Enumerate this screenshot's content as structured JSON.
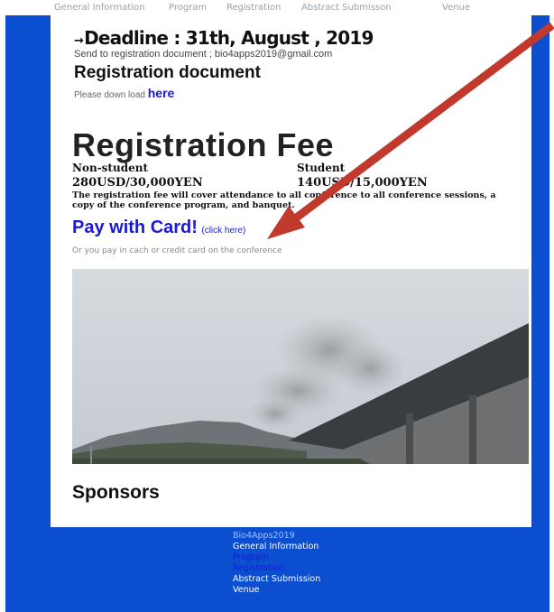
{
  "topnav": {
    "items": [
      "General Information",
      "Program",
      "Registration",
      "Abstract Submisson",
      "Venue"
    ]
  },
  "deadline": {
    "arrow": "→",
    "text": "Deadline : 31th, August , 2019",
    "send_to": "Send to registration document ; bio4apps2019@gmail.com"
  },
  "registration_document": {
    "heading": "Registration document",
    "download_prefix": "Please down load",
    "download_link": "here"
  },
  "fee": {
    "title": "Registration Fee",
    "non_student_label": "Non-student",
    "non_student_price": "280USD/30,000YEN",
    "student_label": "Student",
    "student_price": "140USD/15,000YEN",
    "note": "The registration fee will cover attendance to all conference to all conference sessions, a copy of the conference program, and banquet."
  },
  "payment": {
    "pay_label": "Pay with Card!",
    "click_here": "(click here)",
    "or_pay": "Or you pay in cach or credit card on the conference"
  },
  "sponsors": {
    "heading": "Sponsors"
  },
  "footer": {
    "site_title": "Bio4Apps2019",
    "links": [
      "General Information",
      "Program",
      "Registration",
      "Abstract Submission",
      "Venue"
    ]
  },
  "colors": {
    "background_blue": "#0b4fd0",
    "link_blue": "#1a1ad6",
    "arrow_red": "#c0392b"
  }
}
